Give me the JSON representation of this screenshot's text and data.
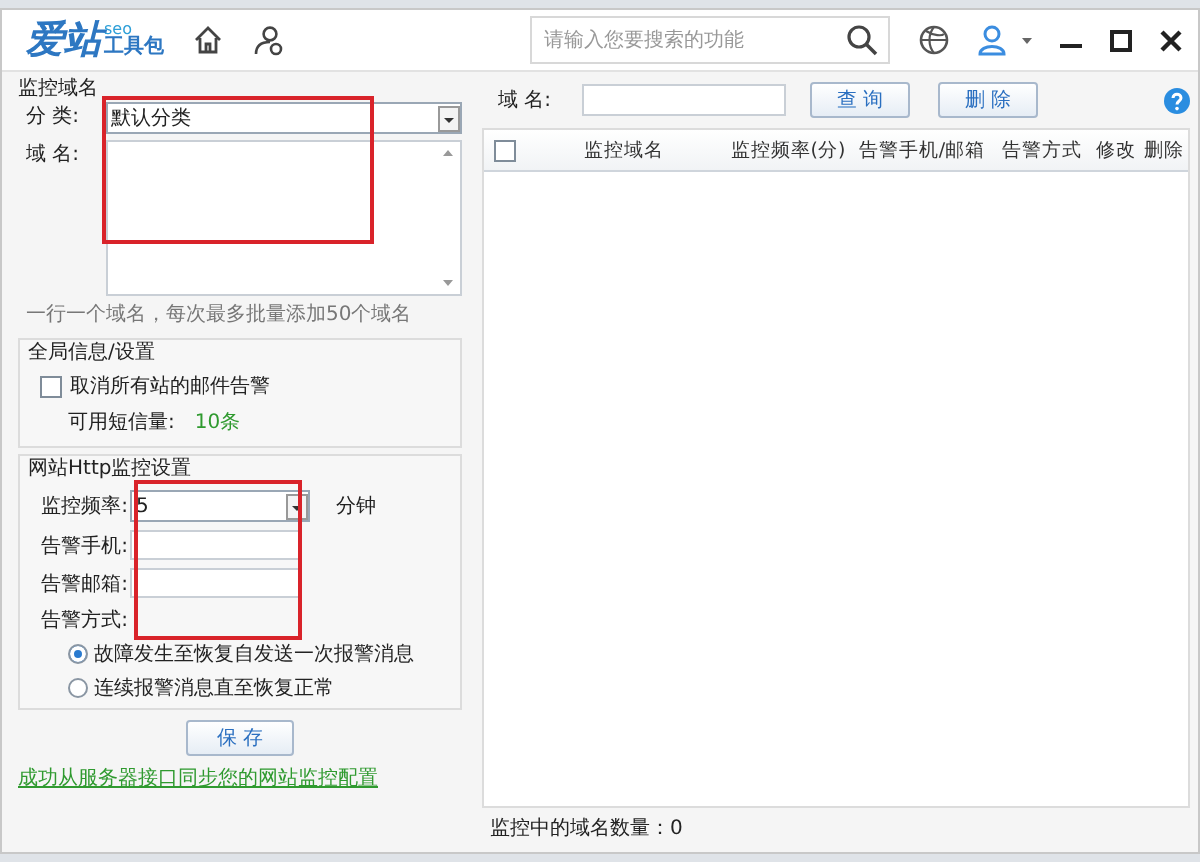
{
  "window": {
    "logo": "爱站",
    "logo_sup": "seo",
    "logo_sub": "工具包",
    "search": {
      "placeholder": "请输入您要搜索的功能"
    }
  },
  "monitor": {
    "title": "监控域名",
    "category_label": "分 类:",
    "category_value": "默认分类",
    "domain_label": "域 名:",
    "hint": "一行一个域名，每次最多批量添加50个域名"
  },
  "global": {
    "title": "全局信息/设置",
    "checkbox": {
      "label": "取消所有站的邮件告警",
      "checked": false
    },
    "sms_label": "可用短信量:",
    "sms_value": "10条"
  },
  "http": {
    "title": "网站Http监控设置",
    "freq_label": "监控频率:",
    "freq_value": "5",
    "freq_unit": "分钟",
    "phone_label": "告警手机:",
    "email_label": "告警邮箱:",
    "mode_label": "告警方式:",
    "modes": [
      {
        "label": "故障发生至恢复自发送一次报警消息",
        "selected": true
      },
      {
        "label": "连续报警消息直至恢复正常",
        "selected": false
      }
    ]
  },
  "save_button": "保 存",
  "status": "成功从服务器接口同步您的网站监控配置",
  "query": {
    "domain_label": "域 名:",
    "buttons": [
      "查 询",
      "删 除"
    ]
  },
  "table": {
    "select_all": false,
    "columns": [
      "监控域名",
      "监控频率(分)",
      "告警手机/邮箱",
      "告警方式",
      "修改",
      "删除"
    ]
  },
  "footer": "监控中的域名数量：0"
}
